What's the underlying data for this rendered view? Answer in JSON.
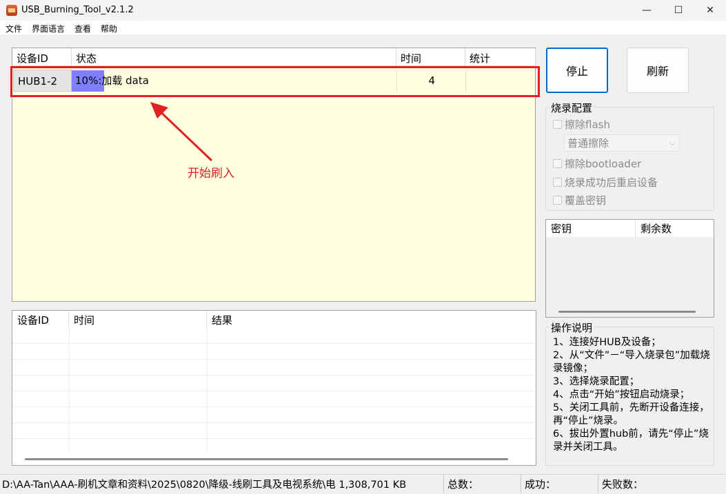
{
  "window": {
    "title": "USB_Burning_Tool_v2.1.2",
    "minimize": "—",
    "maximize": "☐",
    "close": "✕"
  },
  "menu": [
    "文件",
    "界面语言",
    "查看",
    "帮助"
  ],
  "device_list": {
    "columns": [
      "设备ID",
      "状态",
      "时间",
      "统计"
    ],
    "rows": [
      {
        "device_id": "HUB1-2",
        "status": "10%:加载 data",
        "progress": 0.1,
        "time": "4",
        "stat": ""
      }
    ]
  },
  "annotation": {
    "text": "开始刷入",
    "color": "#e02020"
  },
  "log_list": {
    "columns": [
      "设备ID",
      "时间",
      "结果"
    ]
  },
  "buttons": {
    "stop": "停止",
    "refresh": "刷新"
  },
  "burn_config": {
    "title": "烧录配置",
    "erase_flash": "擦除flash",
    "erase_mode": "普通擦除",
    "erase_bootloader": "擦除bootloader",
    "reboot_after": "烧录成功后重启设备",
    "overwrite_key": "覆盖密钥"
  },
  "key_list": {
    "columns": [
      "密钥",
      "剩余数"
    ]
  },
  "instructions": {
    "title": "操作说明",
    "lines": [
      "1、连接好HUB及设备；",
      "2、从“文件”－“导入烧录包”加载烧录镜像；",
      "3、选择烧录配置；",
      "4、点击“开始”按钮启动烧录；",
      "5、关闭工具前，先断开设备连接，再“停止”烧录。",
      "6、拔出外置hub前，请先“停止”烧录并关闭工具。"
    ]
  },
  "status_bar": {
    "path": "D:\\AA-Tan\\AAA-刷机文章和资料\\2025\\0820\\降级-线刷工具及电视系统\\电 1,308,701 KB",
    "total": "总数：",
    "success": "成功：",
    "fail": "失败数："
  }
}
